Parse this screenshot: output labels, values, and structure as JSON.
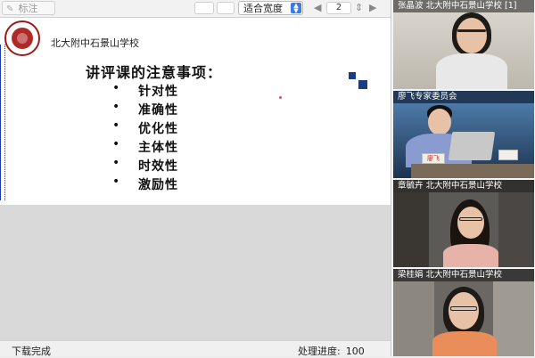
{
  "toolbar": {
    "annotate_label": "标注",
    "fit_label": "适合宽度",
    "page_number": "2"
  },
  "slide": {
    "school_name": "北大附中石景山学校",
    "title": "讲评课的注意事项：",
    "bullets": [
      "针对性",
      "准确性",
      "优化性",
      "主体性",
      "时效性",
      "激励性"
    ]
  },
  "status": {
    "left": "下载完成",
    "progress_label": "处理进度:",
    "progress_value": "100"
  },
  "participants": [
    {
      "label": "张晶波  北大附中石景山学校 [1]"
    },
    {
      "label": "廖飞专家委员会"
    },
    {
      "label": "章毓卉  北大附中石景山学校"
    },
    {
      "label": "梁桂娟  北大附中石景山学校"
    }
  ],
  "name_plate": "廖飞",
  "colors": {
    "accent": "#3b7be8",
    "slide_bar": "#1c3aa8",
    "logo": "#9b1c1c"
  }
}
